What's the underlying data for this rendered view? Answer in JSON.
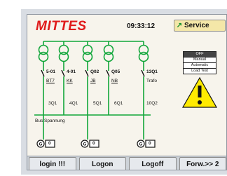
{
  "header": {
    "title": "MITTES",
    "time": "09:33:12",
    "service_label": "Service"
  },
  "feeders": [
    {
      "breaker": "5-01",
      "tag": "BT7",
      "section": "3Q1"
    },
    {
      "breaker": "4-01",
      "tag": "KK",
      "section": "4Q1"
    },
    {
      "breaker": "Q02",
      "tag": "JB",
      "section": "5Q1"
    },
    {
      "breaker": "Q05",
      "tag": "NB",
      "section": "6Q1"
    },
    {
      "breaker": "13Q1",
      "tag": "Trafo",
      "section": "10Q2"
    }
  ],
  "bus_label": "Bus Spannung",
  "generators": [
    {
      "value": "0"
    },
    {
      "value": "0"
    },
    {
      "value": "0"
    }
  ],
  "mode_panel": {
    "items": [
      "OFF",
      "Manual",
      "Automatic",
      "Load Test"
    ]
  },
  "toolbar": {
    "buttons": [
      "login !!!",
      "Logon",
      "Logoff",
      "Forw.>> 2"
    ]
  },
  "colors": {
    "title": "#e01b1b",
    "line": "#11a63a",
    "warning": "#ffeb00",
    "service_button": "#f4e7a8"
  }
}
